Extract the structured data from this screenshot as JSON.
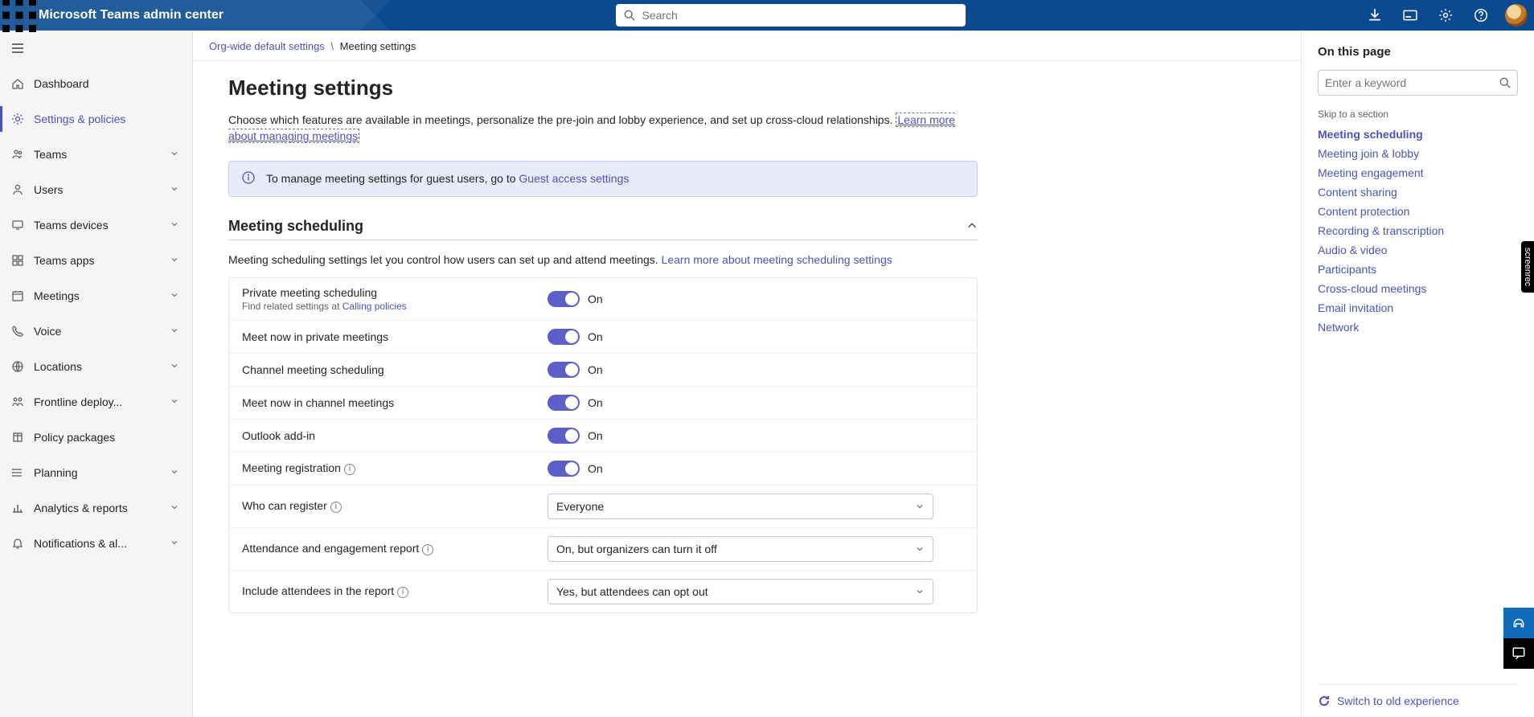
{
  "header": {
    "title": "Microsoft Teams admin center",
    "search_placeholder": "Search"
  },
  "sidebar": {
    "items": [
      {
        "label": "Dashboard",
        "icon": "home",
        "expandable": false,
        "active": false
      },
      {
        "label": "Settings & policies",
        "icon": "gear",
        "expandable": false,
        "active": true
      },
      {
        "label": "Teams",
        "icon": "teams",
        "expandable": true,
        "active": false
      },
      {
        "label": "Users",
        "icon": "user",
        "expandable": true,
        "active": false
      },
      {
        "label": "Teams devices",
        "icon": "device",
        "expandable": true,
        "active": false
      },
      {
        "label": "Teams apps",
        "icon": "apps",
        "expandable": true,
        "active": false
      },
      {
        "label": "Meetings",
        "icon": "calendar",
        "expandable": true,
        "active": false
      },
      {
        "label": "Voice",
        "icon": "phone",
        "expandable": true,
        "active": false
      },
      {
        "label": "Locations",
        "icon": "globe",
        "expandable": true,
        "active": false
      },
      {
        "label": "Frontline deploy...",
        "icon": "frontline",
        "expandable": true,
        "active": false
      },
      {
        "label": "Policy packages",
        "icon": "package",
        "expandable": false,
        "active": false
      },
      {
        "label": "Planning",
        "icon": "planning",
        "expandable": true,
        "active": false
      },
      {
        "label": "Analytics & reports",
        "icon": "analytics",
        "expandable": true,
        "active": false
      },
      {
        "label": "Notifications & al...",
        "icon": "bell",
        "expandable": true,
        "active": false
      }
    ]
  },
  "breadcrumb": {
    "parent": "Org-wide default settings",
    "sep": "\\",
    "current": "Meeting settings"
  },
  "page": {
    "title": "Meeting settings",
    "desc_pre": "Choose which features are available in meetings, personalize the pre-join and lobby experience, and set up cross-cloud relationships. ",
    "desc_link": "Learn more about managing meetings",
    "banner_text": "To manage meeting settings for guest users, go to ",
    "banner_link": "Guest access settings"
  },
  "section": {
    "title": "Meeting scheduling",
    "desc_pre": "Meeting scheduling settings let you control how users can set up and attend meetings. ",
    "desc_link": "Learn more about meeting scheduling settings"
  },
  "settings": {
    "toggle_on_label": "On",
    "rows": [
      {
        "label": "Private meeting scheduling",
        "type": "toggle",
        "state": "On",
        "sub_pre": "Find related settings at ",
        "sub_link": "Calling policies"
      },
      {
        "label": "Meet now in private meetings",
        "type": "toggle",
        "state": "On"
      },
      {
        "label": "Channel meeting scheduling",
        "type": "toggle",
        "state": "On"
      },
      {
        "label": "Meet now in channel meetings",
        "type": "toggle",
        "state": "On"
      },
      {
        "label": "Outlook add-in",
        "type": "toggle",
        "state": "On"
      },
      {
        "label": "Meeting registration",
        "type": "toggle",
        "state": "On",
        "info": true
      },
      {
        "label": "Who can register",
        "type": "select",
        "value": "Everyone",
        "info": true
      },
      {
        "label": "Attendance and engagement report",
        "type": "select",
        "value": "On, but organizers can turn it off",
        "info": true
      },
      {
        "label": "Include attendees in the report",
        "type": "select",
        "value": "Yes, but attendees can opt out",
        "info": true
      }
    ]
  },
  "rightnav": {
    "title": "On this page",
    "search_placeholder": "Enter a keyword",
    "skip_label": "Skip to a section",
    "links": [
      {
        "label": "Meeting scheduling",
        "active": true
      },
      {
        "label": "Meeting join & lobby"
      },
      {
        "label": "Meeting engagement"
      },
      {
        "label": "Content sharing"
      },
      {
        "label": "Content protection"
      },
      {
        "label": "Recording & transcription"
      },
      {
        "label": "Audio & video"
      },
      {
        "label": "Participants"
      },
      {
        "label": "Cross-cloud meetings"
      },
      {
        "label": "Email invitation"
      },
      {
        "label": "Network"
      }
    ],
    "switch_label": "Switch to old experience"
  },
  "badges": {
    "screenrec": "screenrec"
  }
}
